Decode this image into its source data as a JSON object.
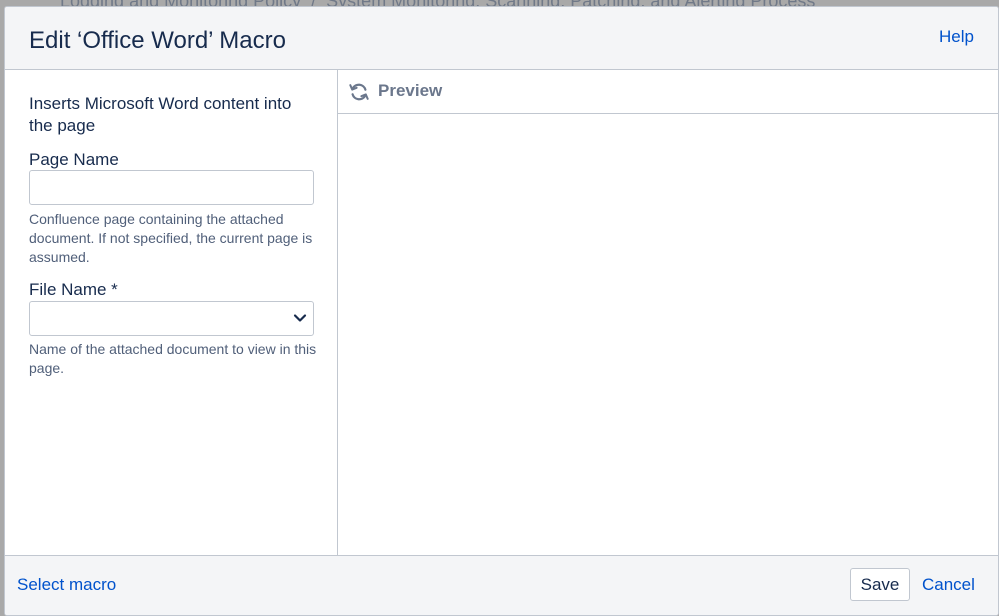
{
  "backdrop": {
    "breadcrumb_parent": "Logging and Monitoring Policy",
    "breadcrumb_separator": "/",
    "breadcrumb_current": "System Monitoring, Scanning, Patching, and Alerting Process"
  },
  "dialog": {
    "title": "Edit ‘Office Word’ Macro",
    "help_label": "Help"
  },
  "form": {
    "description": "Inserts Microsoft Word content into the page",
    "page_name": {
      "label": "Page Name",
      "value": "",
      "help": "Confluence page containing the attached document. If not specified, the current page is assumed."
    },
    "file_name": {
      "label": "File Name *",
      "selected": "",
      "help": "Name of the attached document to view in this page."
    }
  },
  "preview": {
    "title": "Preview",
    "refresh_icon": "refresh-icon"
  },
  "footer": {
    "select_macro_label": "Select macro",
    "save_label": "Save",
    "cancel_label": "Cancel"
  },
  "colors": {
    "link": "#0052cc",
    "text": "#172b4d",
    "border": "#c1c7d0",
    "panel_bg": "#f4f5f7"
  }
}
